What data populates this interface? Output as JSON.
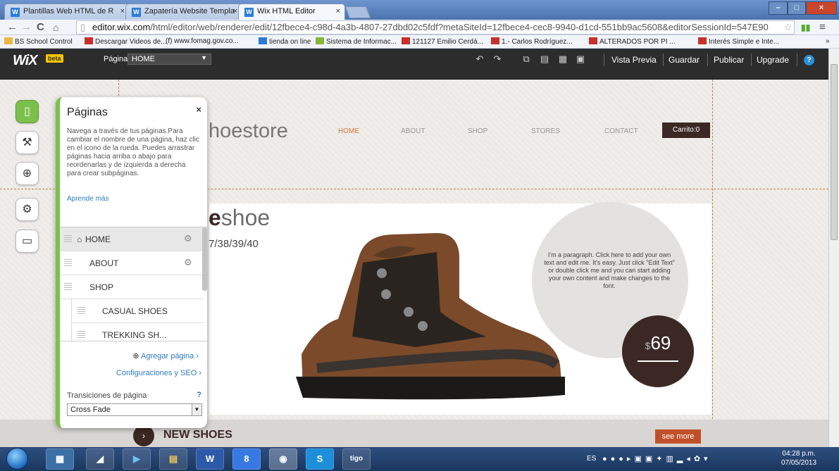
{
  "browser": {
    "tabs": [
      {
        "title": "Plantillas Web HTML de R",
        "active": false
      },
      {
        "title": "Zapatería Website Templa",
        "active": false
      },
      {
        "title": "Wix HTML Editor",
        "active": true
      }
    ],
    "url_host": "editor.wix.com",
    "url_path": "/html/editor/web/renderer/edit/12fbece4-c98d-4a3b-4807-27dbd02c5fdf?metaSiteId=12fbece4-cec8-9940-d1cd-551bb9ac5608&editorSessionId=547E90",
    "bookmarks": [
      "BS School Control",
      "Descargar Videos de...",
      "(f) www.fomag.gov.co...",
      "tienda on line",
      "Sistema de Informac...",
      "121127 Emilio Cerdá...",
      "1.- Carlos Rodríguez...",
      "ALTERADOS POR PI ...",
      "Interés Simple e Inte..."
    ],
    "bookmarks_more": "»"
  },
  "wix_toolbar": {
    "logo": "WiX",
    "beta": "beta",
    "page_label": "Página",
    "page_value": "HOME",
    "preview": "Vista Previa",
    "save": "Guardar",
    "publish": "Publicar",
    "upgrade": "Upgrade",
    "help": "?"
  },
  "site": {
    "brand": "hoestore",
    "nav": [
      "HOME",
      "ABOUT",
      "SHOP",
      "STORES",
      "CONTACT"
    ],
    "cart": "Carrito:0",
    "hero_title_bold": "e",
    "hero_title_rest": "shoe",
    "sizes": "7/38/39/40",
    "paragraph": "I'm a paragraph. Click here to add your own text and edit me. It's easy. Just click \"Edit Text\" or double click me and you can start adding your own content and make changes to the font.",
    "price_symbol": "$",
    "price": "69",
    "new_shoes": "NEW SHOES",
    "see_more": "see more"
  },
  "pages_panel": {
    "title": "Páginas",
    "close": "×",
    "description": "Navega a través de tus páginas.Para cambiar el nombre de una página, haz clic en el icono de la rueda. Puedes arrastrar páginas hacia arriba o abajo para reordenarlas y de izquierda a derecha para crear subpáginas.",
    "learn_more": "Aprende más",
    "pages": [
      {
        "label": "HOME",
        "home": true,
        "subpage": false,
        "gear": true,
        "selected": true
      },
      {
        "label": "ABOUT",
        "home": false,
        "subpage": false,
        "gear": true,
        "selected": false
      },
      {
        "label": "SHOP",
        "home": false,
        "subpage": false,
        "gear": false,
        "selected": false
      },
      {
        "label": "CASUAL SHOES",
        "home": false,
        "subpage": true,
        "gear": false,
        "selected": false
      },
      {
        "label": "TREKKING SH...",
        "home": false,
        "subpage": true,
        "gear": false,
        "selected": false
      }
    ],
    "add_page": "Agregar página",
    "settings_seo": "Configuraciones y SEO",
    "transitions_label": "Transiciones de página",
    "transitions_help": "?",
    "transition_value": "Cross Fade"
  },
  "taskbar": {
    "language": "ES",
    "time": "04:28 p.m.",
    "date": "07/05/2013"
  },
  "colors": {
    "wix_green": "#7bc04a",
    "shoe_brown": "#3b2825",
    "accent_orange": "#d4773a",
    "link_blue": "#2b7bc0"
  }
}
